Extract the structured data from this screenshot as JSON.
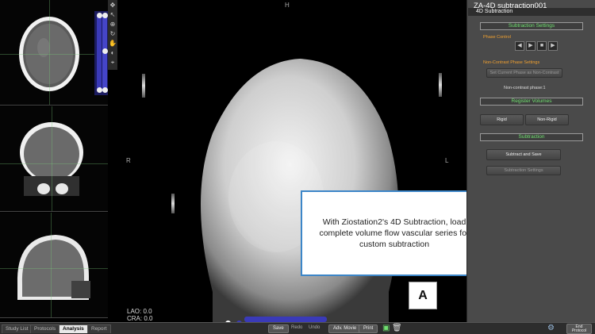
{
  "viewer": {
    "orient_top": "H",
    "orient_left": "R",
    "orient_right": "L",
    "lao_label": "LAO: 0.0",
    "cra_label": "CRA: 0.0"
  },
  "caption": {
    "text": "With Ziostation2's 4D Subtraction, load complete volume flow vascular series for custom subtraction",
    "badge": "A"
  },
  "panel": {
    "title": "ZA-4D subtraction001",
    "subtitle": "4D Subtraction",
    "subtraction_settings": "Subtraction Settings",
    "phase_control": "Phase Control",
    "noncontrast_settings": "Non-Contrast Phase Settings",
    "set_current_button": "Set Current Phase as Non-Contrast",
    "noncontrast_phase": "Non-contrast phase:1",
    "register_volumes": "Register Volumes",
    "rigid_button": "Rigid",
    "nonrigid_button": "Non-Rigid",
    "subtraction_section": "Subtraction",
    "subtract_save_button": "Subtract and Save",
    "subtraction_settings_button": "Subtraction Settings"
  },
  "bottom": {
    "tabs": [
      "Study List",
      "Protocols",
      "Analysis",
      "Report"
    ],
    "save": "Save",
    "redo": "Redo",
    "undo": "Undo",
    "adv_movie": "Adv. Movie",
    "print": "Print",
    "end_protocol": "End Protocol"
  },
  "colors": {
    "accent_green": "#6fe16f",
    "accent_orange": "#f0a030",
    "slider_blue": "#3a3ab8",
    "caption_border": "#3c86c8"
  },
  "icons": [
    "gear-icon",
    "camera-icon",
    "recycle-bin-icon",
    "play-icon",
    "pause-icon",
    "stop-icon",
    "step-back-icon",
    "step-forward-icon"
  ]
}
